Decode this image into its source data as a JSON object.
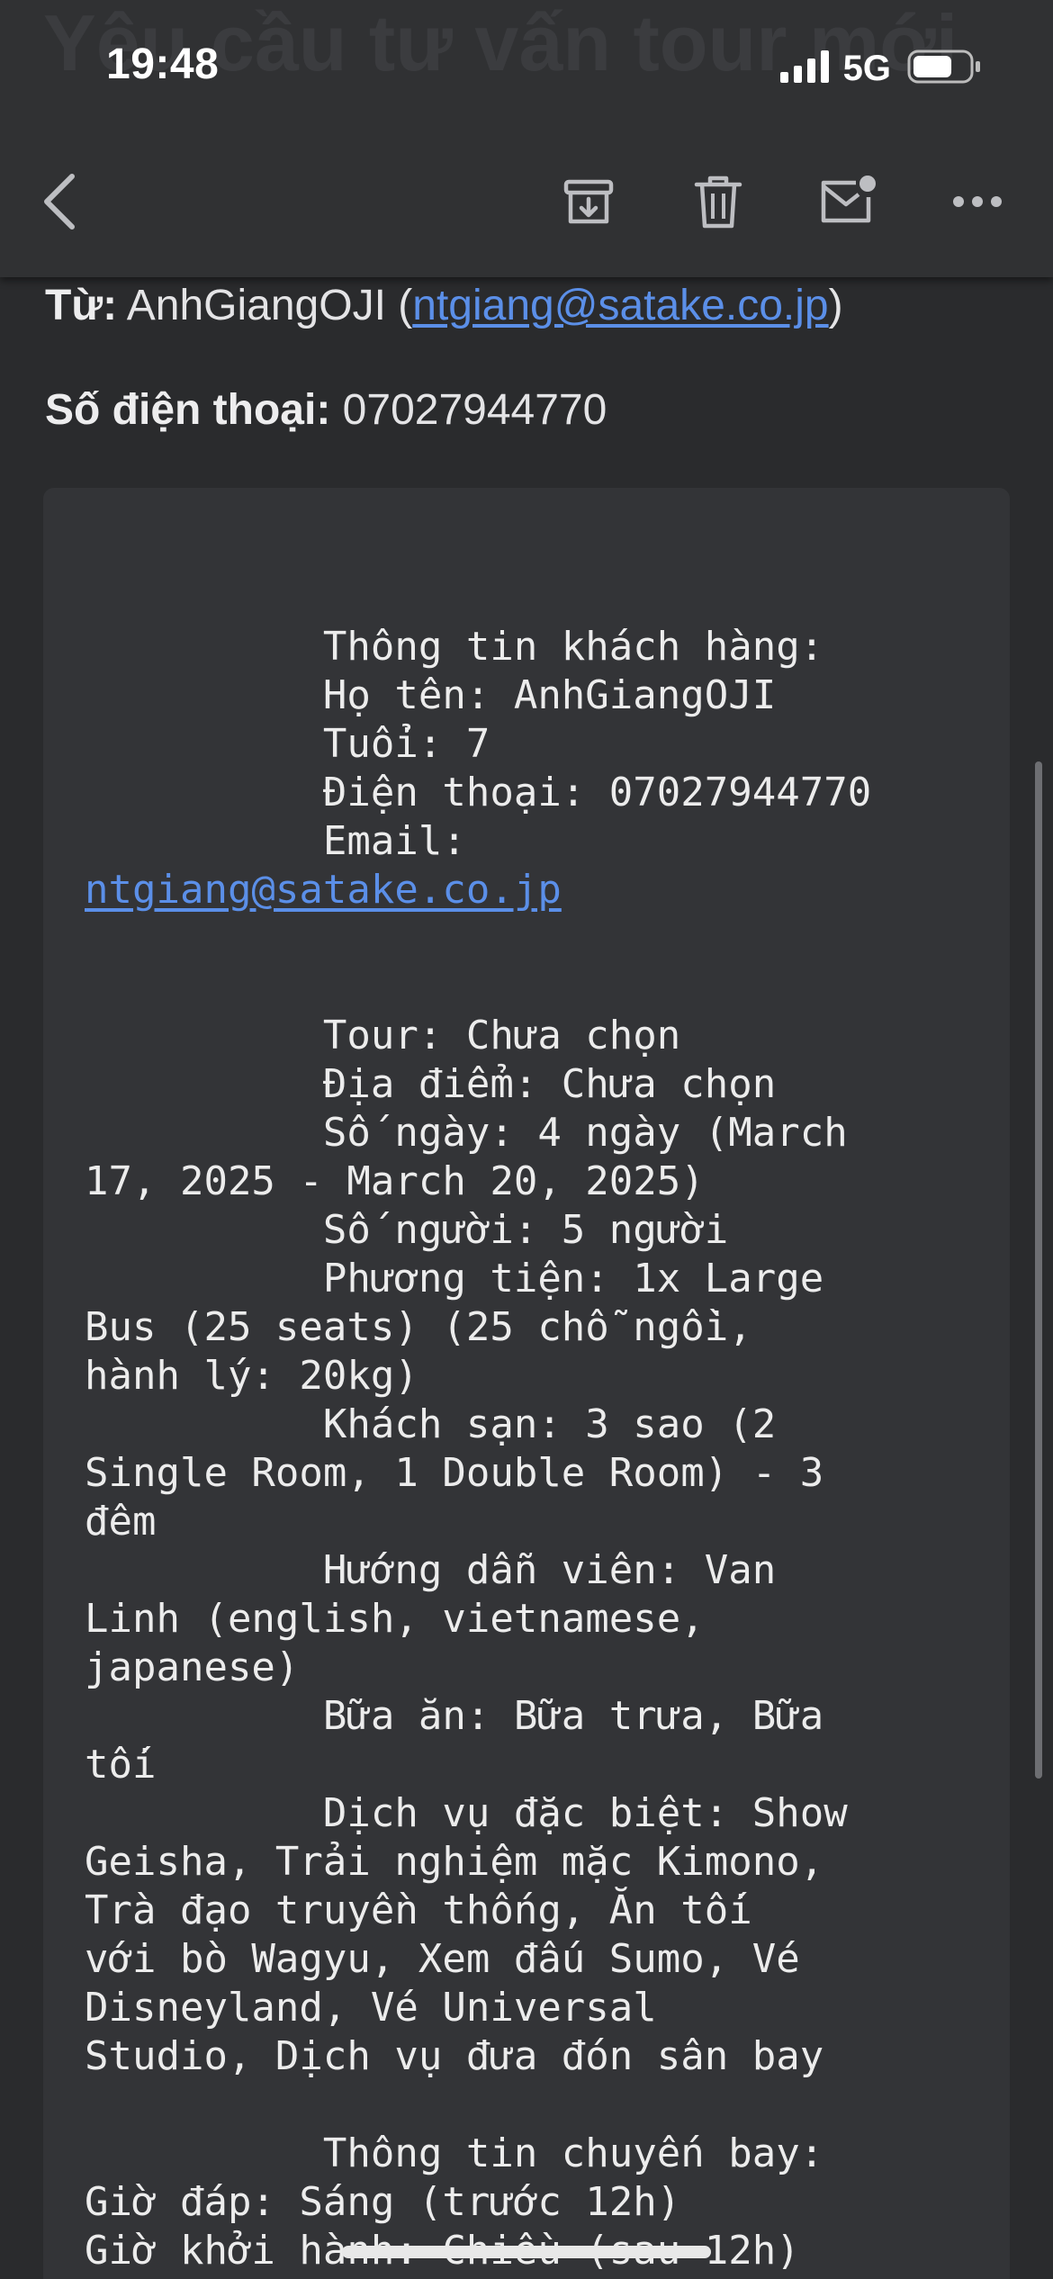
{
  "status_bar": {
    "time": "19:48",
    "network": "5G"
  },
  "header": {
    "ghost_title": "Yêu cầu tư vấn tour mới",
    "icons": [
      "back-chevron",
      "archive-box",
      "trash",
      "mail-unread",
      "more-horizontal"
    ]
  },
  "meta": {
    "from_label": "Từ:",
    "from_name": "AnhGiangOJI",
    "open_paren": " (",
    "from_email": "ntgiang@satake.co.jp",
    "close_paren": ")",
    "phone_label": "Số điện thoại:",
    "phone_value": "07027944770"
  },
  "body_lines": [
    "          Thông tin khách hàng:",
    "          Họ tên: AnhGiangOJI",
    "          Tuổi: 7",
    "          Điện thoại: 07027944770",
    "          Email:",
    "ntgiang@satake.co.jp",
    "",
    "",
    "          Tour: Chưa chọn",
    "          Địa điểm: Chưa chọn",
    "          Số ngày: 4 ngày (March",
    "17, 2025 - March 20, 2025)",
    "          Số người: 5 người",
    "          Phương tiện: 1x Large",
    "Bus (25 seats) (25 chỗ ngồi,",
    "hành lý: 20kg)",
    "          Khách sạn: 3 sao (2",
    "Single Room, 1 Double Room) - 3",
    "đêm",
    "          Hướng dẫn viên: Van",
    "Linh (english, vietnamese,",
    "japanese)",
    "          Bữa ăn: Bữa trưa, Bữa",
    "tối",
    "          Dịch vụ đặc biệt: Show",
    "Geisha, Trải nghiệm mặc Kimono,",
    "Trà đạo truyền thống, Ăn tối",
    "với bò Wagyu, Xem đấu Sumo, Vé",
    "Disneyland, Vé Universal",
    "Studio, Dịch vụ đưa đón sân bay",
    "",
    "          Thông tin chuyến bay:",
    "Giờ đáp: Sáng (trước 12h)",
    "Giờ khởi hành: Chiều (sau 12h)"
  ],
  "colors": {
    "background": "#2a2b2d",
    "header": "#303133",
    "link": "#5b8fe8",
    "codebox": "#333437"
  }
}
